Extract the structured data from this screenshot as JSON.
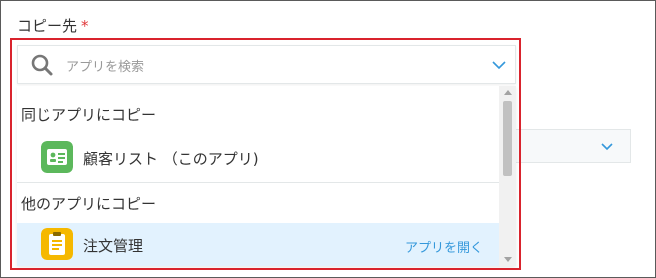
{
  "field": {
    "label": "コピー先",
    "required_mark": "*"
  },
  "search": {
    "placeholder": "アプリを検索",
    "icon": "search-icon"
  },
  "dropdown": {
    "sections": [
      {
        "header": "同じアプリにコピー",
        "items": [
          {
            "name": "顧客リスト （このアプリ)",
            "icon": "customer-list-app-icon",
            "selected": false
          }
        ]
      },
      {
        "header": "他のアプリにコピー",
        "items": [
          {
            "name": "注文管理",
            "icon": "order-management-app-icon",
            "selected": true,
            "action": "アプリを開く"
          }
        ]
      }
    ]
  },
  "colors": {
    "highlight_border": "#d9232d",
    "required": "#e0383a",
    "link": "#3498db",
    "selected_row": "#e2f2fe",
    "customer_icon": "#5cb85c",
    "order_icon": "#f5b800"
  }
}
